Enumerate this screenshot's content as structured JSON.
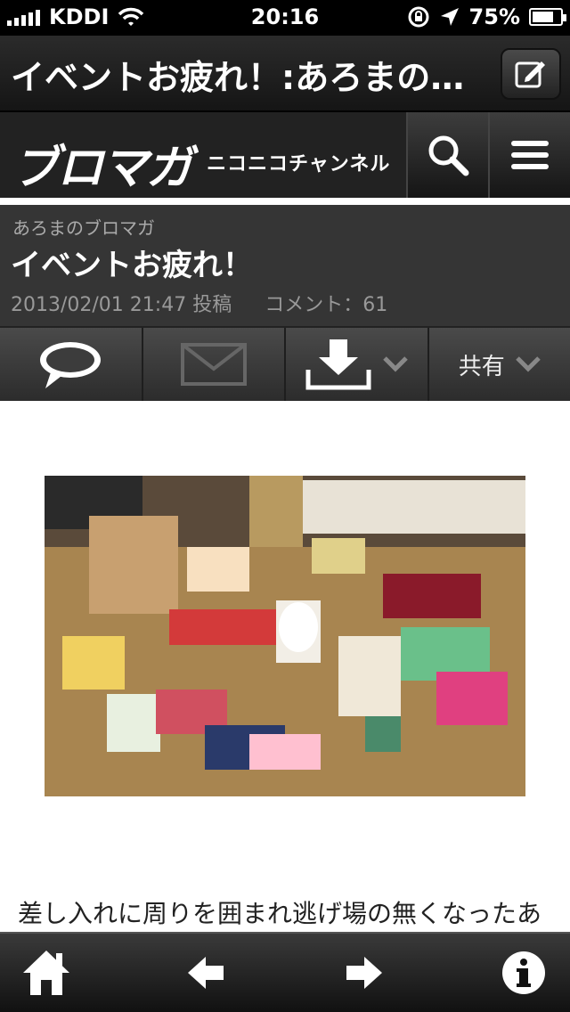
{
  "status_bar": {
    "carrier": "KDDI",
    "time": "20:16",
    "battery_text": "75%",
    "battery_level": 0.75
  },
  "title_bar": {
    "title": "イベントお疲れ！:あろまの…",
    "compose_icon": "compose-icon"
  },
  "site_header": {
    "logo": "ブロマガ",
    "sublogo": "ニコニコチャンネル",
    "search_icon": "search-icon",
    "menu_icon": "menu-icon"
  },
  "article": {
    "blog_name": "あろまのブロマガ",
    "title": "イベントお疲れ！",
    "date": "2013/02/01 21:47 投稿",
    "comment_label": "コメント：61"
  },
  "action_bar": {
    "comment_icon": "speech-bubble-icon",
    "mail_icon": "envelope-icon",
    "download_icon": "download-icon",
    "share_label": "共有"
  },
  "content": {
    "photo": "photo-of-gifts",
    "body_text": "差し入れに周りを囲まれ逃げ場の無くなったあ"
  },
  "toolbar": {
    "home_icon": "home-icon",
    "back_icon": "arrow-left-icon",
    "forward_icon": "arrow-right-icon",
    "info_icon": "info-icon"
  },
  "colors": {
    "bar_dark": "#222222",
    "header_gray": "#353535",
    "text_muted": "#999999"
  }
}
